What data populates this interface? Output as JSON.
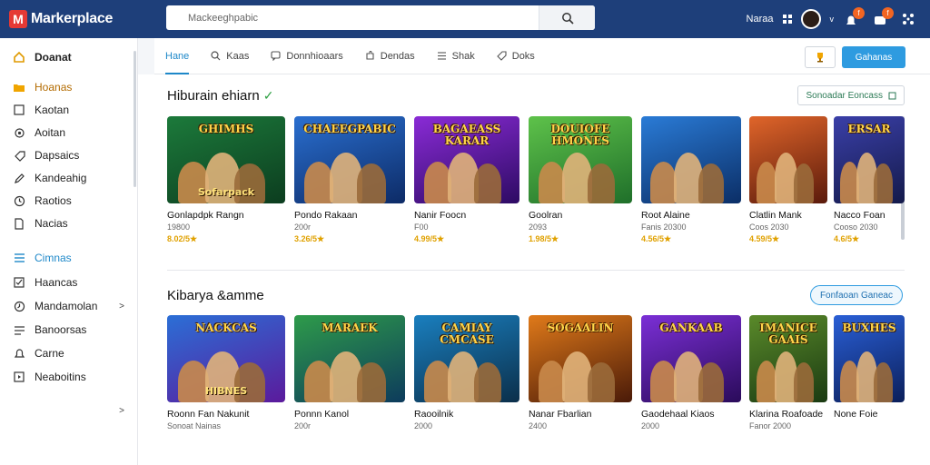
{
  "app": {
    "logo_letter": "M",
    "name": "Markerplace"
  },
  "search": {
    "placeholder": "Mackeeghpabic"
  },
  "topbar": {
    "user_label": "Naraa",
    "badge_1": "f",
    "badge_2": "f"
  },
  "sidebar": {
    "items": [
      {
        "label": "Doanat",
        "icon": "home-icon"
      },
      {
        "label": "Hoanas",
        "icon": "folder-icon"
      },
      {
        "label": "Kaotan",
        "icon": "square-icon"
      },
      {
        "label": "Aoitan",
        "icon": "gear-icon"
      },
      {
        "label": "Dapsaics",
        "icon": "tag-icon"
      },
      {
        "label": "Kandeahig",
        "icon": "pencil-icon"
      },
      {
        "label": "Raotios",
        "icon": "clock-icon"
      },
      {
        "label": "Nacias",
        "icon": "doc-icon"
      }
    ],
    "games_items": [
      {
        "label": "Cimnas",
        "icon": "list-icon"
      },
      {
        "label": "Haancas",
        "icon": "check-box-icon"
      },
      {
        "label": "Mandamolan",
        "icon": "clock-icon"
      },
      {
        "label": "Banoorsas",
        "icon": "menu-icon"
      },
      {
        "label": "Carne",
        "icon": "bell-icon"
      },
      {
        "label": "Neaboitins",
        "icon": "play-icon"
      }
    ]
  },
  "tabs": [
    {
      "label": "Hane"
    },
    {
      "label": "Kaas"
    },
    {
      "label": "Donnhioaars"
    },
    {
      "label": "Dendas"
    },
    {
      "label": "Shak"
    },
    {
      "label": "Doks"
    }
  ],
  "toolbar": {
    "primary_label": "Gahanas"
  },
  "section1": {
    "title": "Hiburain ehiarn",
    "action": "Sonoadar Eoncass",
    "cards": [
      {
        "thumb": "GHIMHS",
        "thumb_sub": "Sofarpack",
        "title": "Gonlapdpk Rangn",
        "sub": "19800",
        "rating": "8.02/5★",
        "colors": [
          "#1c7a3b",
          "#0c3d1f"
        ]
      },
      {
        "thumb": "CHAEEGPABIC",
        "thumb_sub": "",
        "title": "Pondo Rakaan",
        "sub": "200r",
        "rating": "3.26/5★",
        "colors": [
          "#2a6fd0",
          "#0d2b66"
        ]
      },
      {
        "thumb": "BAGAEASS KARAR",
        "thumb_sub": "",
        "title": "Nanir Foocn",
        "sub": "F00",
        "rating": "4.99/5★",
        "colors": [
          "#8a2bd6",
          "#2d0b63"
        ]
      },
      {
        "thumb": "DOUIOFE HMONES",
        "thumb_sub": "",
        "title": "Goolran",
        "sub": "2093",
        "rating": "1.98/5★",
        "colors": [
          "#5ec24a",
          "#1f6f2a"
        ]
      },
      {
        "thumb": "",
        "thumb_sub": "",
        "title": "Root Alaine",
        "sub": "Fanis 20300",
        "rating": "4.56/5★",
        "colors": [
          "#2a7bd6",
          "#0b2e66"
        ]
      },
      {
        "thumb": "",
        "thumb_sub": "",
        "title": "Clatlin Mank",
        "sub": "Coos 2030",
        "rating": "4.59/5★",
        "colors": [
          "#e0652a",
          "#5a1a0b"
        ]
      },
      {
        "thumb": "ERSAR",
        "thumb_sub": "",
        "title": "Nacco Foan",
        "sub": "Cooso 2030",
        "rating": "4.6/5★",
        "colors": [
          "#3a3fa8",
          "#141a4a"
        ]
      }
    ]
  },
  "section2": {
    "title": "Kibarya &amme",
    "action": "Fonfaoan Ganeac",
    "cards": [
      {
        "thumb": "NACKCAS",
        "thumb_sub": "HIBNES",
        "title": "Roonn Fan Nakunit",
        "sub": "Sonoat Nainas",
        "rating": "",
        "colors": [
          "#2b6fd6",
          "#5b1a9c"
        ]
      },
      {
        "thumb": "MARAEK",
        "thumb_sub": "",
        "title": "Ponnn Kanol",
        "sub": "200r",
        "rating": "",
        "colors": [
          "#2e9b4a",
          "#0d3b5c"
        ]
      },
      {
        "thumb": "CAMIAY CMCASE",
        "thumb_sub": "",
        "title": "Raooilnik",
        "sub": "2000",
        "rating": "",
        "colors": [
          "#1a7fbf",
          "#0b2f4a"
        ]
      },
      {
        "thumb": "SOGAALIN",
        "thumb_sub": "",
        "title": "Nanar Fbarlian",
        "sub": "2400",
        "rating": "",
        "colors": [
          "#e07a1a",
          "#4a1a08"
        ]
      },
      {
        "thumb": "GANKAAB",
        "thumb_sub": "",
        "title": "Gaodehaal Kiaos",
        "sub": "2000",
        "rating": "",
        "colors": [
          "#7b2fd6",
          "#2a0b5a"
        ]
      },
      {
        "thumb": "IMANICE GAAIS",
        "thumb_sub": "",
        "title": "Klarina Roafoade",
        "sub": "Fanor 2000",
        "rating": "",
        "colors": [
          "#5a8a2a",
          "#1a3a12"
        ]
      },
      {
        "thumb": "BUXHES",
        "thumb_sub": "",
        "title": "None Foie",
        "sub": "",
        "rating": "",
        "colors": [
          "#2a5fd6",
          "#0b1f5a"
        ]
      }
    ]
  }
}
